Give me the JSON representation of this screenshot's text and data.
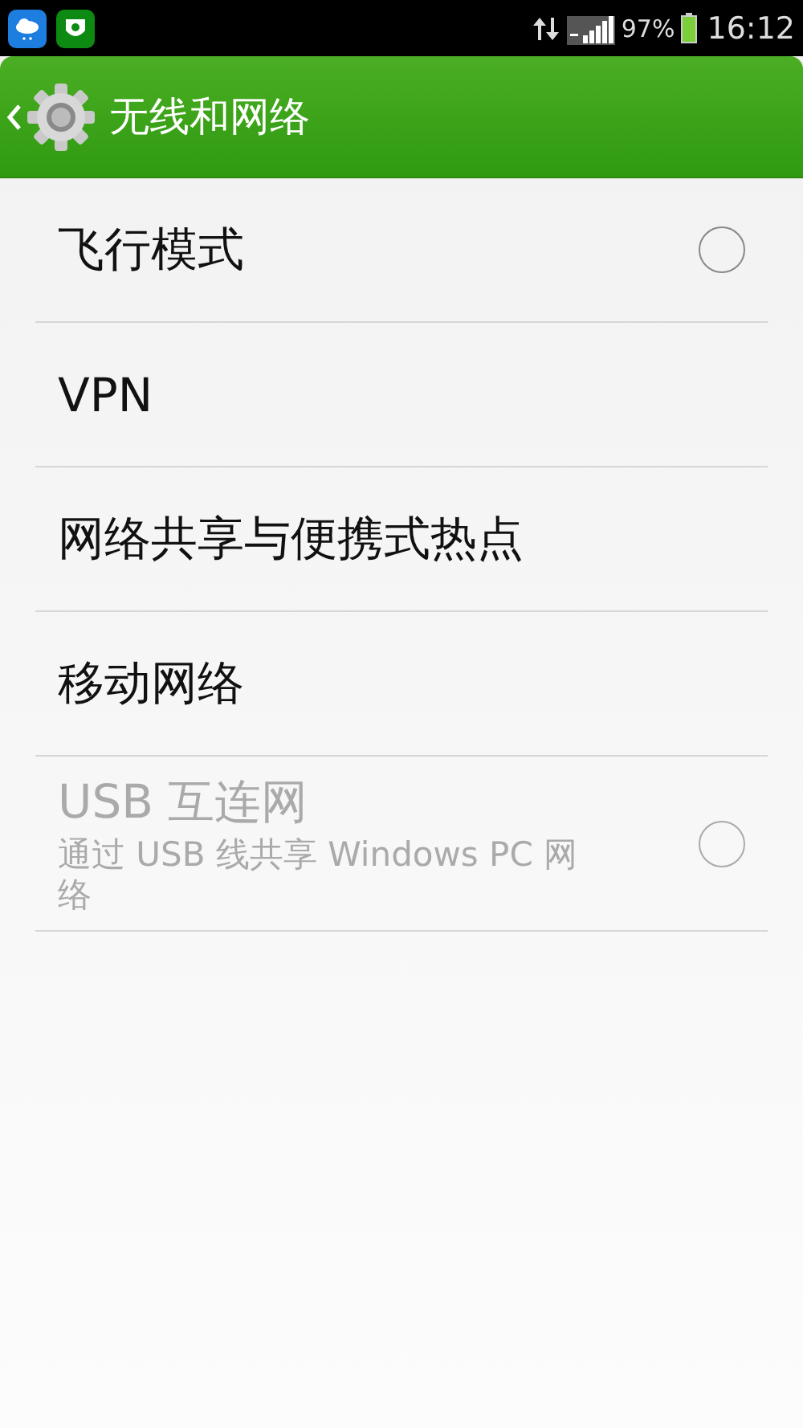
{
  "status_bar": {
    "battery": "97%",
    "time": "16:12"
  },
  "header": {
    "title": "无线和网络"
  },
  "items": [
    {
      "kind": "checkbox",
      "title": "飞行模式",
      "checked": false,
      "disabled": false
    },
    {
      "kind": "link",
      "title": "VPN",
      "disabled": false
    },
    {
      "kind": "link",
      "title": "网络共享与便携式热点",
      "disabled": false
    },
    {
      "kind": "link",
      "title": "移动网络",
      "disabled": false
    },
    {
      "kind": "checkbox",
      "title": "USB 互连网",
      "summary": "通过 USB 线共享 Windows PC 网络",
      "checked": false,
      "disabled": true
    }
  ]
}
